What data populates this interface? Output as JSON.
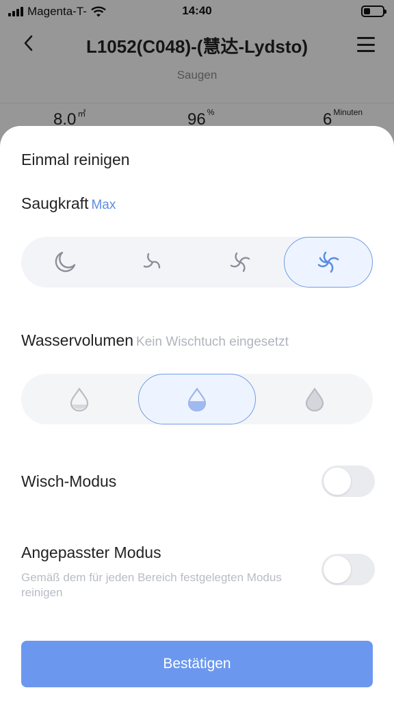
{
  "status_bar": {
    "carrier": "Magenta-T-",
    "time": "14:40"
  },
  "nav": {
    "back_icon": "chevron-left-icon",
    "title": "L1052(C048)-(慧达-Lydsto)",
    "menu_icon": "hamburger-icon"
  },
  "subtitle": "Saugen",
  "stats": [
    {
      "value": "8.0",
      "unit": "㎡"
    },
    {
      "value": "96",
      "unit": "%"
    },
    {
      "value": "6",
      "unit": "Minuten"
    }
  ],
  "sheet": {
    "title": "Einmal reinigen",
    "suction": {
      "label": "Saugkraft",
      "value": "Max",
      "options": [
        "moon-icon",
        "fan-low-icon",
        "fan-mid-icon",
        "fan-max-icon"
      ],
      "selected_index": 3
    },
    "water": {
      "label": "Wasservolumen",
      "hint": "Kein Wischtuch eingesetzt",
      "options": [
        "drop-low-icon",
        "drop-mid-icon",
        "drop-high-icon"
      ],
      "selected_index": 1
    },
    "mop_mode": {
      "label": "Wisch-Modus",
      "enabled": false
    },
    "custom_mode": {
      "label": "Angepasster Modus",
      "description": "Gemäß dem für jeden Bereich festgelegten Modus reinigen",
      "enabled": false
    },
    "confirm_label": "Bestätigen"
  },
  "colors": {
    "accent": "#6b98ee",
    "accent_text": "#5b8de2",
    "hint_grey": "#b0b4bc"
  }
}
